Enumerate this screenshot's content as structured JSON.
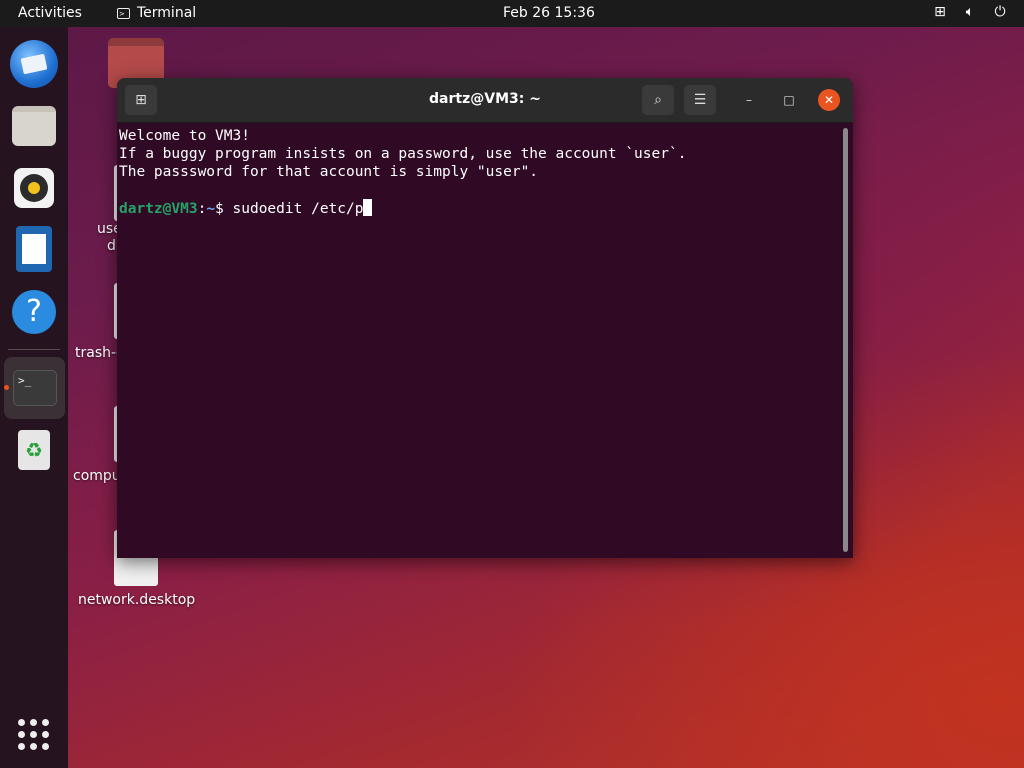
{
  "topbar": {
    "activities": "Activities",
    "app_name": "Terminal",
    "clock": "Feb 26  15:36",
    "tray_icons": [
      "network-icon",
      "volume-icon",
      "power-icon"
    ]
  },
  "dock": {
    "items": [
      {
        "name": "thunderbird-icon"
      },
      {
        "name": "files-icon"
      },
      {
        "name": "rhythmbox-icon"
      },
      {
        "name": "libreoffice-writer-icon"
      },
      {
        "name": "help-icon",
        "glyph": "?"
      },
      {
        "name": "terminal-icon",
        "glyph": ">_",
        "running": true
      },
      {
        "name": "trash-icon",
        "glyph": "♻"
      }
    ],
    "show_apps": "show-apps-icon"
  },
  "desktop": {
    "icons": [
      {
        "label": "use",
        "label2": "d"
      },
      {
        "label": "trash-d"
      },
      {
        "label": "compu"
      },
      {
        "label": "network.desktop"
      }
    ]
  },
  "terminal": {
    "title": "dartz@VM3: ~",
    "lines": [
      "Welcome to VM3!",
      "If a buggy program insists on a password, use the account `user`.",
      "The passsword for that account is simply \"user\"."
    ],
    "prompt_user": "dartz@VM3",
    "prompt_path": "~",
    "prompt_symbol": "$",
    "command": "sudoedit /etc/p"
  },
  "colors": {
    "accent": "#e95420",
    "terminal_bg": "#300a24",
    "prompt_user": "#26a269",
    "prompt_path": "#6ea2f0"
  }
}
